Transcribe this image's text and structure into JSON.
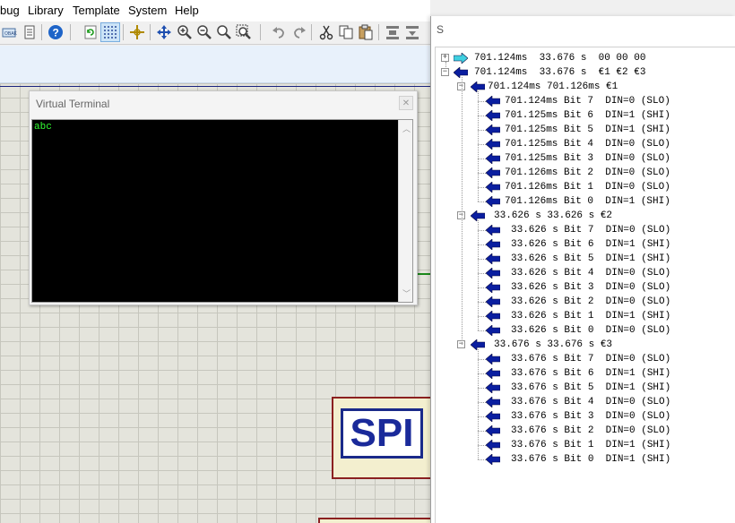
{
  "menu": [
    "bug",
    "Library",
    "Template",
    "System",
    "Help"
  ],
  "toolbar_icons": [
    "open-icon",
    "document-icon",
    "help-icon",
    "refresh-icon",
    "grid-icon",
    "origin-icon",
    "pan-icon",
    "zoom-in-icon",
    "zoom-out-icon",
    "zoom-all-icon",
    "zoom-area-icon",
    "undo-icon",
    "redo-icon",
    "cut-icon",
    "copy-icon",
    "paste-icon",
    "block-copy-icon",
    "block-move-icon"
  ],
  "terminal": {
    "title": "Virtual Terminal",
    "text": "abc"
  },
  "spi_label": "SPI",
  "debugger": {
    "title": "S",
    "header": {
      "time_start": "701.124ms",
      "time_end": "33.676 s",
      "data": "00 00 00"
    },
    "transaction": {
      "time_start": "701.124ms",
      "time_end": "33.676 s",
      "data": "€1 €2 €3"
    },
    "bytes": [
      {
        "time_start": "701.124ms",
        "time_end": "701.126ms",
        "value": "€1",
        "bits": [
          {
            "time": "701.124ms",
            "bit": "Bit 7",
            "din": "DIN=0",
            "level": "(SLO)"
          },
          {
            "time": "701.125ms",
            "bit": "Bit 6",
            "din": "DIN=1",
            "level": "(SHI)"
          },
          {
            "time": "701.125ms",
            "bit": "Bit 5",
            "din": "DIN=1",
            "level": "(SHI)"
          },
          {
            "time": "701.125ms",
            "bit": "Bit 4",
            "din": "DIN=0",
            "level": "(SLO)"
          },
          {
            "time": "701.125ms",
            "bit": "Bit 3",
            "din": "DIN=0",
            "level": "(SLO)"
          },
          {
            "time": "701.126ms",
            "bit": "Bit 2",
            "din": "DIN=0",
            "level": "(SLO)"
          },
          {
            "time": "701.126ms",
            "bit": "Bit 1",
            "din": "DIN=0",
            "level": "(SLO)"
          },
          {
            "time": "701.126ms",
            "bit": "Bit 0",
            "din": "DIN=1",
            "level": "(SHI)"
          }
        ]
      },
      {
        "time_start": "33.626 s",
        "time_end": "33.626 s",
        "value": "€2",
        "bits": [
          {
            "time": "33.626 s",
            "bit": "Bit 7",
            "din": "DIN=0",
            "level": "(SLO)"
          },
          {
            "time": "33.626 s",
            "bit": "Bit 6",
            "din": "DIN=1",
            "level": "(SHI)"
          },
          {
            "time": "33.626 s",
            "bit": "Bit 5",
            "din": "DIN=1",
            "level": "(SHI)"
          },
          {
            "time": "33.626 s",
            "bit": "Bit 4",
            "din": "DIN=0",
            "level": "(SLO)"
          },
          {
            "time": "33.626 s",
            "bit": "Bit 3",
            "din": "DIN=0",
            "level": "(SLO)"
          },
          {
            "time": "33.626 s",
            "bit": "Bit 2",
            "din": "DIN=0",
            "level": "(SLO)"
          },
          {
            "time": "33.626 s",
            "bit": "Bit 1",
            "din": "DIN=1",
            "level": "(SHI)"
          },
          {
            "time": "33.626 s",
            "bit": "Bit 0",
            "din": "DIN=0",
            "level": "(SLO)"
          }
        ]
      },
      {
        "time_start": "33.676 s",
        "time_end": "33.676 s",
        "value": "€3",
        "bits": [
          {
            "time": "33.676 s",
            "bit": "Bit 7",
            "din": "DIN=0",
            "level": "(SLO)"
          },
          {
            "time": "33.676 s",
            "bit": "Bit 6",
            "din": "DIN=1",
            "level": "(SHI)"
          },
          {
            "time": "33.676 s",
            "bit": "Bit 5",
            "din": "DIN=1",
            "level": "(SHI)"
          },
          {
            "time": "33.676 s",
            "bit": "Bit 4",
            "din": "DIN=0",
            "level": "(SLO)"
          },
          {
            "time": "33.676 s",
            "bit": "Bit 3",
            "din": "DIN=0",
            "level": "(SLO)"
          },
          {
            "time": "33.676 s",
            "bit": "Bit 2",
            "din": "DIN=0",
            "level": "(SLO)"
          },
          {
            "time": "33.676 s",
            "bit": "Bit 1",
            "din": "DIN=1",
            "level": "(SHI)"
          },
          {
            "time": "33.676 s",
            "bit": "Bit 0",
            "din": "DIN=1",
            "level": "(SHI)"
          }
        ]
      }
    ]
  },
  "colors": {
    "arrow_blue": "#0a1ea0",
    "arrow_cyan": "#3fd0e0",
    "terminal_text": "#33ff33",
    "spi_border": "#8b2020",
    "spi_text": "#1a2a9a"
  }
}
